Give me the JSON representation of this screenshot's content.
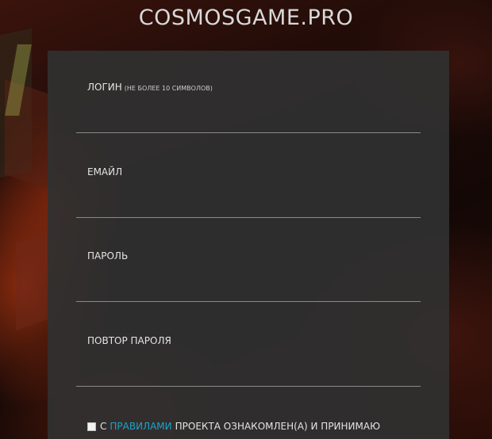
{
  "site": {
    "title": "COSMOSGAME.PRO"
  },
  "form": {
    "fields": [
      {
        "label": "ЛОГИН",
        "hint": "(НЕ БОЛЕЕ 10 СИМВОЛОВ)",
        "value": ""
      },
      {
        "label": "ЕМАЙЛ",
        "hint": "",
        "value": ""
      },
      {
        "label": "ПАРОЛЬ",
        "hint": "",
        "value": ""
      },
      {
        "label": "ПОВТОР ПАРОЛЯ",
        "hint": "",
        "value": ""
      }
    ],
    "agreement": {
      "checked": false,
      "prefix": "С",
      "link_text": "ПРАВИЛАМИ",
      "suffix": "ПРОЕКТА ОЗНАКОМЛЕН(А) И ПРИНИМАЮ"
    }
  },
  "colors": {
    "panel": "#303030",
    "link": "#1fa2c8",
    "title": "#d8d8d8"
  }
}
